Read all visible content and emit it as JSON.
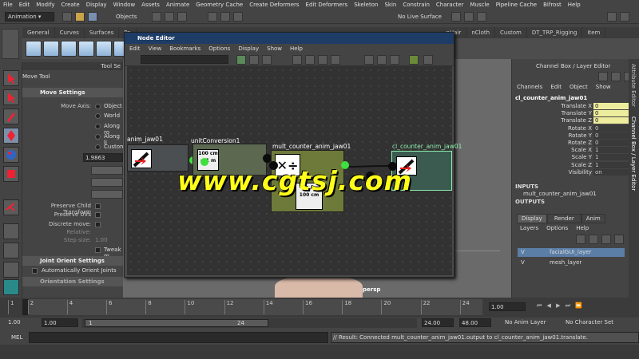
{
  "menubar": [
    "File",
    "Edit",
    "Modify",
    "Create",
    "Display",
    "Window",
    "Assets",
    "Animate",
    "Geometry Cache",
    "Create Deformers",
    "Edit Deformers",
    "Skeleton",
    "Skin",
    "Constrain",
    "Character",
    "Muscle",
    "Pipeline Cache",
    "Bifrost",
    "Help"
  ],
  "status": {
    "mode": "Animation",
    "objects": "Objects",
    "live_surface": "No Live Surface"
  },
  "shelf_tabs": [
    "General",
    "Curves",
    "Surfaces",
    "Po",
    "nHair",
    "nCloth",
    "Custom",
    "DT_TRP_Rigging",
    "Item"
  ],
  "tool": {
    "panel_title": "Tool Se",
    "name": "Move Tool"
  },
  "move_settings": {
    "header": "Move Settings",
    "axis_label": "Move Axis:",
    "axis_options": [
      "Object",
      "World",
      "Along ro",
      "Along li",
      "Custom"
    ],
    "value": "1.9863",
    "preserve_child": "Preserve Child Transform",
    "preserve_uvs": "Preserve UVs",
    "discrete": "Discrete move:",
    "relative": "Relative:",
    "step_size": "Step size:",
    "step_value": "1.00",
    "tweak": "Tweak m"
  },
  "joint_orient": {
    "header": "Joint Orient Settings",
    "auto": "Automatically Orient Joints",
    "orientation": "Orientation Settings"
  },
  "node_editor": {
    "title": "Node Editor",
    "menu": [
      "Edit",
      "View",
      "Bookmarks",
      "Options",
      "Display",
      "Show",
      "Help"
    ],
    "nodes": [
      {
        "name": "anim_jaw01"
      },
      {
        "name": "unitConversion1",
        "icon_text": "100 cm = 1 m"
      },
      {
        "name": "mult_counter_anim_jaw01",
        "icon_text": "100 cm"
      },
      {
        "name": "cl_counter_anim_jaw01"
      }
    ]
  },
  "watermark": "www.cgtsj.com",
  "viewport": {
    "camera": "persp"
  },
  "channel_box": {
    "title": "Channel Box / Layer Editor",
    "menu": [
      "Channels",
      "Edit",
      "Object",
      "Show"
    ],
    "object": "cl_counter_anim_jaw01",
    "channels": [
      {
        "name": "Translate X",
        "value": "0",
        "highlight": true
      },
      {
        "name": "Translate Y",
        "value": "0",
        "highlight": true
      },
      {
        "name": "Translate Z",
        "value": "0",
        "highlight": true
      },
      {
        "name": "Rotate X",
        "value": "0",
        "highlight": false
      },
      {
        "name": "Rotate Y",
        "value": "0",
        "highlight": false
      },
      {
        "name": "Rotate Z",
        "value": "0",
        "highlight": false
      },
      {
        "name": "Scale X",
        "value": "1",
        "highlight": false
      },
      {
        "name": "Scale Y",
        "value": "1",
        "highlight": false
      },
      {
        "name": "Scale Z",
        "value": "1",
        "highlight": false
      },
      {
        "name": "Visibility",
        "value": "on",
        "highlight": false
      }
    ],
    "inputs_label": "INPUTS",
    "input_node": "mult_counter_anim_jaw01",
    "outputs_label": "OUTPUTS"
  },
  "layer_editor": {
    "tabs": [
      "Display",
      "Render",
      "Anim"
    ],
    "menu": [
      "Layers",
      "Options",
      "Help"
    ],
    "layers": [
      {
        "v": "V",
        "name": "facialGUI_layer",
        "selected": true
      },
      {
        "v": "V",
        "name": "mesh_layer",
        "selected": false
      }
    ]
  },
  "side_tabs": {
    "attribute": "Attribute Editor",
    "channel": "Channel Box / Layer Editor"
  },
  "timeline": {
    "ticks": [
      "1",
      "2",
      "4",
      "6",
      "8",
      "10",
      "12",
      "14",
      "16",
      "18",
      "20",
      "22",
      "24"
    ],
    "current": "1.00"
  },
  "range": {
    "start": "1.00",
    "start2": "1.00",
    "slider_start": "1",
    "slider_end": "24",
    "end": "24.00",
    "end2": "48.00",
    "anim_layer": "No Anim Layer",
    "character": "No Character Set"
  },
  "command": {
    "lang": "MEL",
    "result": "// Result: Connected mult_counter_anim_jaw01.output to cl_counter_anim_jaw01.translate."
  },
  "colors": {
    "selection_yellow": "#eeed9e",
    "node_green": "#3de03d",
    "title_blue": "#1d3c66",
    "layer_selected": "#5b7ea6"
  }
}
